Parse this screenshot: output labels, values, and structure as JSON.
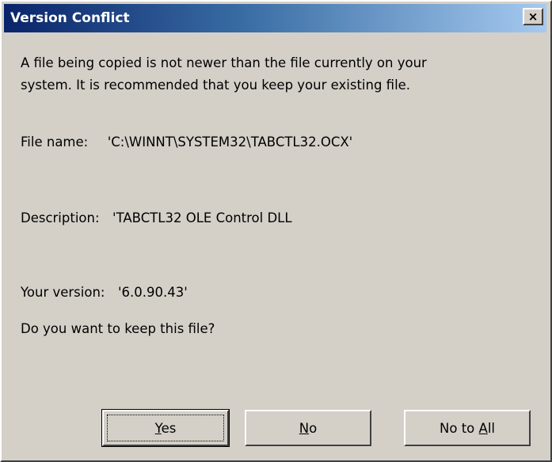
{
  "window": {
    "title": "Version Conflict",
    "close_glyph": "×"
  },
  "message": {
    "line1": "A file being copied is not newer than the file currently on your",
    "line2": "system. It is recommended that you keep your existing file."
  },
  "details": {
    "file_name_label": "File name:",
    "file_name_value": "'C:\\WINNT\\SYSTEM32\\TABCTL32.OCX'",
    "description_label": "Description:",
    "description_value": "'TABCTL32 OLE Control DLL",
    "version_label": "Your version:",
    "version_value": "'6.0.90.43'"
  },
  "question": "Do you want to keep this file?",
  "buttons": {
    "yes": {
      "label": "Yes",
      "mnemonic": "Y",
      "rest": "es"
    },
    "no": {
      "label": "No",
      "mnemonic": "N",
      "rest": "o"
    },
    "no_to_all": {
      "label": "No to All",
      "prefix": "No to ",
      "mnemonic": "A",
      "rest": "ll"
    }
  },
  "colors": {
    "titlebar_start": "#0a246a",
    "titlebar_end": "#a6caf0",
    "face": "#d4d0c8"
  }
}
